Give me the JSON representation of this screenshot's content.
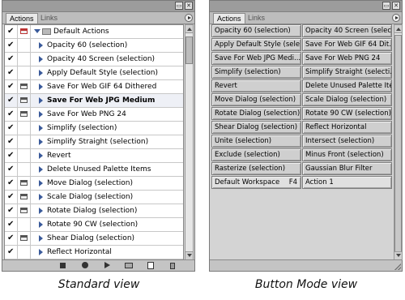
{
  "standard": {
    "tabs": [
      "Actions",
      "Links"
    ],
    "set_name": "Default Actions",
    "items": [
      {
        "label": "Opacity 60 (selection)",
        "checked": true,
        "dialog": false,
        "selected": false
      },
      {
        "label": "Opacity 40 Screen (selection)",
        "checked": true,
        "dialog": false,
        "selected": false
      },
      {
        "label": "Apply Default Style (selection)",
        "checked": true,
        "dialog": false,
        "selected": false
      },
      {
        "label": "Save For Web GIF 64 Dithered",
        "checked": true,
        "dialog": true,
        "selected": false
      },
      {
        "label": "Save For Web JPG Medium",
        "checked": true,
        "dialog": true,
        "selected": true
      },
      {
        "label": "Save For Web PNG 24",
        "checked": true,
        "dialog": true,
        "selected": false
      },
      {
        "label": "Simplify (selection)",
        "checked": true,
        "dialog": false,
        "selected": false
      },
      {
        "label": "Simplify Straight (selection)",
        "checked": true,
        "dialog": false,
        "selected": false
      },
      {
        "label": "Revert",
        "checked": true,
        "dialog": false,
        "selected": false
      },
      {
        "label": "Delete Unused Palette Items",
        "checked": true,
        "dialog": false,
        "selected": false
      },
      {
        "label": "Move Dialog (selection)",
        "checked": true,
        "dialog": true,
        "selected": false
      },
      {
        "label": "Scale Dialog (selection)",
        "checked": true,
        "dialog": true,
        "selected": false
      },
      {
        "label": "Rotate Dialog (selection)",
        "checked": true,
        "dialog": true,
        "selected": false
      },
      {
        "label": "Rotate 90 CW (selection)",
        "checked": true,
        "dialog": false,
        "selected": false
      },
      {
        "label": "Shear Dialog (selection)",
        "checked": true,
        "dialog": true,
        "selected": false
      },
      {
        "label": "Reflect Horizontal",
        "checked": true,
        "dialog": false,
        "selected": false
      }
    ],
    "footer_icons": [
      "stop-icon",
      "record-icon",
      "play-icon",
      "new-set-icon",
      "new-action-icon",
      "trash-icon"
    ]
  },
  "button_mode": {
    "tabs": [
      "Actions",
      "Links"
    ],
    "buttons": [
      {
        "left": "Opacity 60 (selection)",
        "right": "Opacity 40 Screen (selec..."
      },
      {
        "left": "Apply Default Style (sele...",
        "right": "Save For Web GIF 64 Dit..."
      },
      {
        "left": "Save For Web JPG Medi...",
        "right": "Save For Web PNG 24"
      },
      {
        "left": "Simplify (selection)",
        "right": "Simplify Straight (selecti..."
      },
      {
        "left": "Revert",
        "right": "Delete Unused Palette Items"
      },
      {
        "left": "Move Dialog (selection)",
        "right": "Scale Dialog (selection)"
      },
      {
        "left": "Rotate Dialog (selection)",
        "right": "Rotate 90 CW (selection)"
      },
      {
        "left": "Shear Dialog (selection)",
        "right": "Reflect Horizontal"
      },
      {
        "left": "Unite (selection)",
        "right": "Intersect (selection)"
      },
      {
        "left": "Exclude (selection)",
        "right": "Minus Front (selection)"
      },
      {
        "left": "Rasterize (selection)",
        "right": "Gaussian Blur Filter"
      },
      {
        "left": "Default Workspace",
        "right": "Action 1"
      }
    ],
    "last_fkey": "F4"
  },
  "captions": {
    "standard": "Standard view",
    "button": "Button Mode view"
  },
  "colors": {
    "panel_bg": "#d4d4d4",
    "titlebar": "#9c9c9c",
    "triangle": "#3a5a9a"
  }
}
